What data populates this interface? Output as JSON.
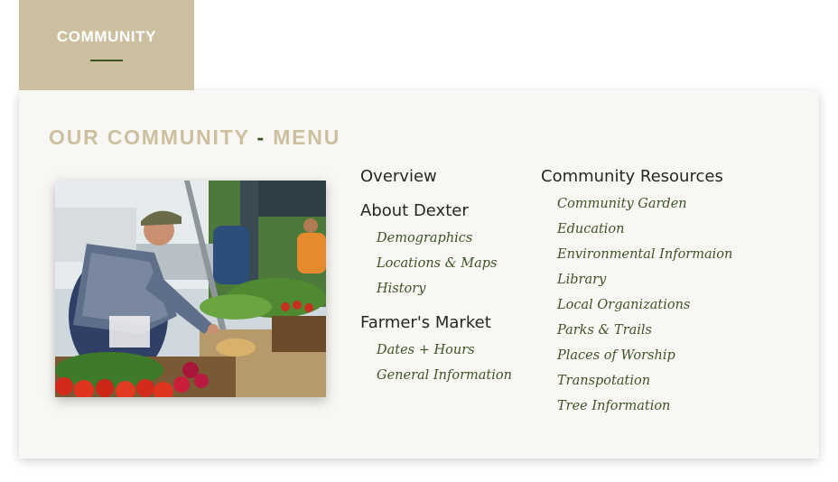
{
  "tab": {
    "label": "COMMUNITY"
  },
  "menu": {
    "title_part1": "OUR COMMUNITY",
    "title_sep": "-",
    "title_part2": "MENU",
    "columns": [
      {
        "sections": [
          {
            "label": "Overview",
            "items": []
          },
          {
            "label": "About Dexter",
            "items": [
              "Demographics",
              "Locations & Maps",
              "History"
            ]
          },
          {
            "label": "Farmer's Market",
            "items": [
              "Dates + Hours",
              "General Information"
            ]
          }
        ]
      },
      {
        "sections": [
          {
            "label": "Community Resources",
            "items": [
              "Community Garden",
              "Education",
              "Environmental Informaion",
              "Library",
              "Local Organizations",
              "Parks & Trails",
              "Places of Worship",
              "Transpotation",
              "Tree Information"
            ]
          }
        ]
      }
    ]
  },
  "colors": {
    "tan": "#cdc0a0",
    "green": "#3b5325",
    "panel_bg": "#f9f7f3"
  },
  "image": {
    "subject": "farmers market vendor arranging produce"
  }
}
